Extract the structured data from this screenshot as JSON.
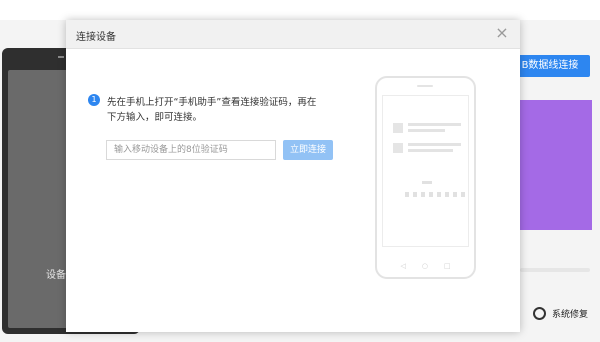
{
  "background": {
    "left_panel": {
      "label": "设备"
    },
    "right_panel": {
      "button_label": "B数据线连接",
      "accent_color": "#2d86f0",
      "card_color": "#a46ae6",
      "repair_label": "系统修复",
      "repair_icon": "gear-icon"
    }
  },
  "dialog": {
    "title": "连接设备",
    "close_icon": "close-icon",
    "step_number": "1",
    "instruction_line1": "先在手机上打开“手机助手”查看连接验证码，再在",
    "instruction_line2": "下方输入，即可连接。",
    "code_placeholder": "输入移动设备上的8位验证码",
    "connect_button_label": "立即连接",
    "phone_nav_icons": [
      "back-icon",
      "home-icon",
      "recent-icon"
    ]
  }
}
